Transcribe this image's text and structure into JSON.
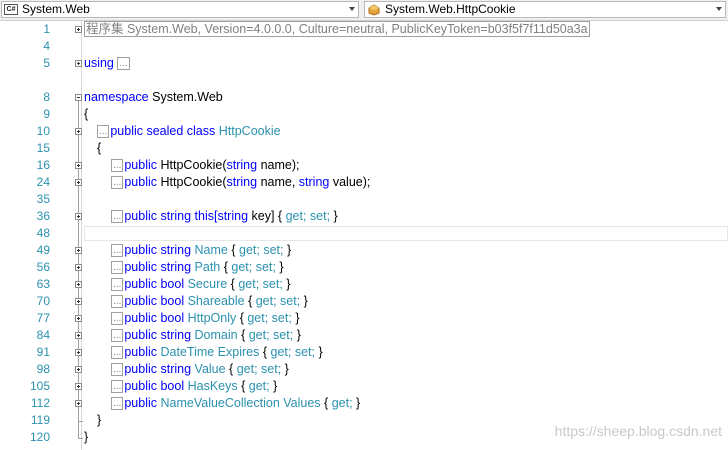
{
  "navbar": {
    "type_combo": {
      "icon_text": "C#",
      "text": "System.Web"
    },
    "member_combo": {
      "text": "System.Web.HttpCookie"
    }
  },
  "editor": {
    "lines": [
      {
        "num": "1"
      },
      {
        "num": "4"
      },
      {
        "num": "5"
      },
      {
        "num": "8"
      },
      {
        "num": "9"
      },
      {
        "num": "10"
      },
      {
        "num": "15"
      },
      {
        "num": "16"
      },
      {
        "num": "24"
      },
      {
        "num": "35"
      },
      {
        "num": "36"
      },
      {
        "num": "48"
      },
      {
        "num": "49"
      },
      {
        "num": "56"
      },
      {
        "num": "63"
      },
      {
        "num": "70"
      },
      {
        "num": "77"
      },
      {
        "num": "84"
      },
      {
        "num": "91"
      },
      {
        "num": "98"
      },
      {
        "num": "105"
      },
      {
        "num": "112"
      },
      {
        "num": "119"
      },
      {
        "num": "120"
      }
    ],
    "ellipsis": "...",
    "assembly": "程序集 System.Web, Version=4.0.0.0, Culture=neutral, PublicKeyToken=b03f5f7f11d50a3a",
    "using": "using",
    "namespace_kw": "namespace",
    "namespace_name": "System.Web",
    "open_brace": "{",
    "close_brace": "}",
    "class_decl": {
      "mods": "public sealed class",
      "name": "HttpCookie"
    },
    "ctor1": {
      "kw": "public",
      "name": "HttpCookie(",
      "t1": "string",
      "rest": "name);"
    },
    "ctor2": {
      "kw": "public",
      "name": "HttpCookie(",
      "t1": "string",
      "mid": "name,",
      "t2": "string",
      "rest": "value);"
    },
    "indexer": {
      "kw": "public string this[",
      "t": "string",
      "rest": "key] { ",
      "get": "get;",
      "set": "set;",
      "end": " }"
    },
    "props": [
      {
        "mods": "public string",
        "type_user": "",
        "name": "Name",
        "acc": "get; set;"
      },
      {
        "mods": "public string",
        "type_user": "",
        "name": "Path",
        "acc": "get; set;"
      },
      {
        "mods": "public bool",
        "type_user": "",
        "name": "Secure",
        "acc": "get; set;"
      },
      {
        "mods": "public bool",
        "type_user": "",
        "name": "Shareable",
        "acc": "get; set;"
      },
      {
        "mods": "public bool",
        "type_user": "",
        "name": "HttpOnly",
        "acc": "get; set;"
      },
      {
        "mods": "public string",
        "type_user": "",
        "name": "Domain",
        "acc": "get; set;"
      },
      {
        "mods": "public",
        "type_user": "DateTime",
        "name": "Expires",
        "acc": "get; set;"
      },
      {
        "mods": "public string",
        "type_user": "",
        "name": "Value",
        "acc": "get; set;"
      },
      {
        "mods": "public bool",
        "type_user": "",
        "name": "HasKeys",
        "acc": "get;"
      },
      {
        "mods": "public",
        "type_user": "NameValueCollection",
        "name": "Values",
        "acc": "get;"
      }
    ]
  },
  "watermark": "https://sheep.blog.csdn.net"
}
